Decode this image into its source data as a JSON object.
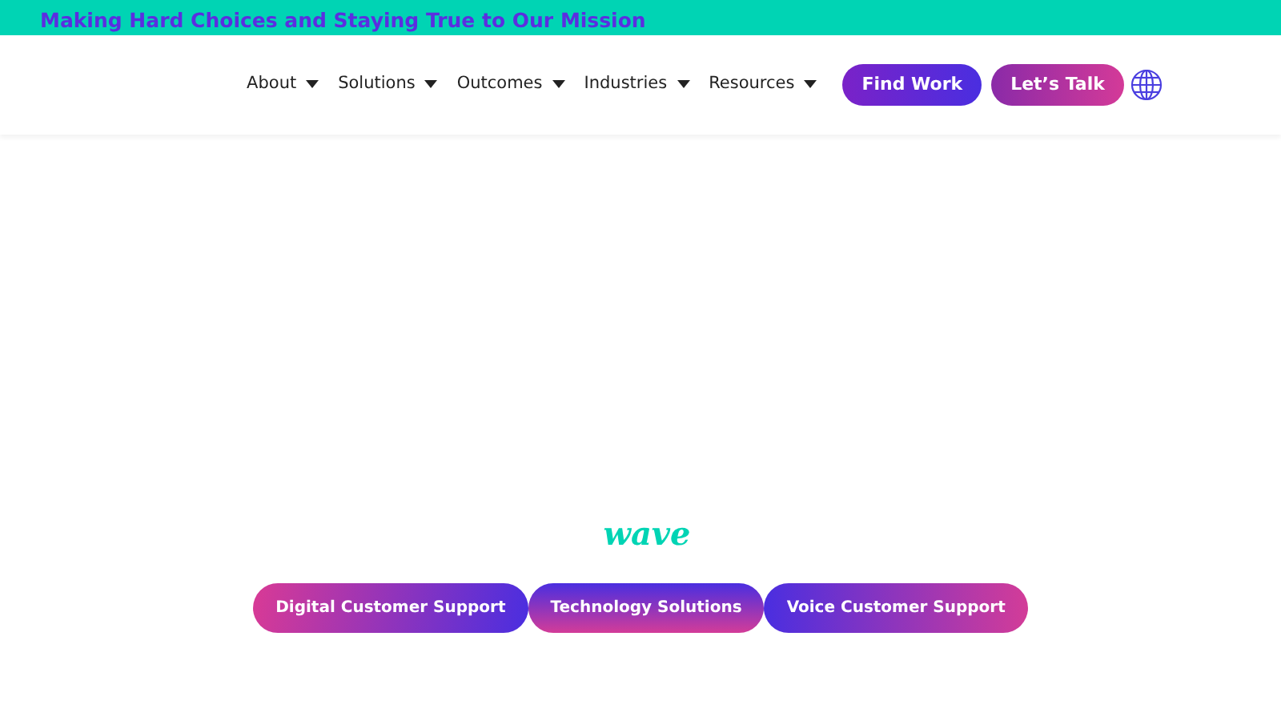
{
  "announcement": {
    "text": "Making Hard Choices and Staying True to Our Mission"
  },
  "nav": {
    "items": [
      {
        "label": "About"
      },
      {
        "label": "Solutions"
      },
      {
        "label": "Outcomes"
      },
      {
        "label": "Industries"
      },
      {
        "label": "Resources"
      }
    ],
    "buttons": [
      {
        "label": "Find Work"
      },
      {
        "label": "Let’s Talk"
      }
    ]
  },
  "hero": {
    "word": "wave",
    "pills": [
      {
        "label": "Digital Customer Support"
      },
      {
        "label": "Technology Solutions"
      },
      {
        "label": "Voice Customer Support"
      }
    ]
  }
}
